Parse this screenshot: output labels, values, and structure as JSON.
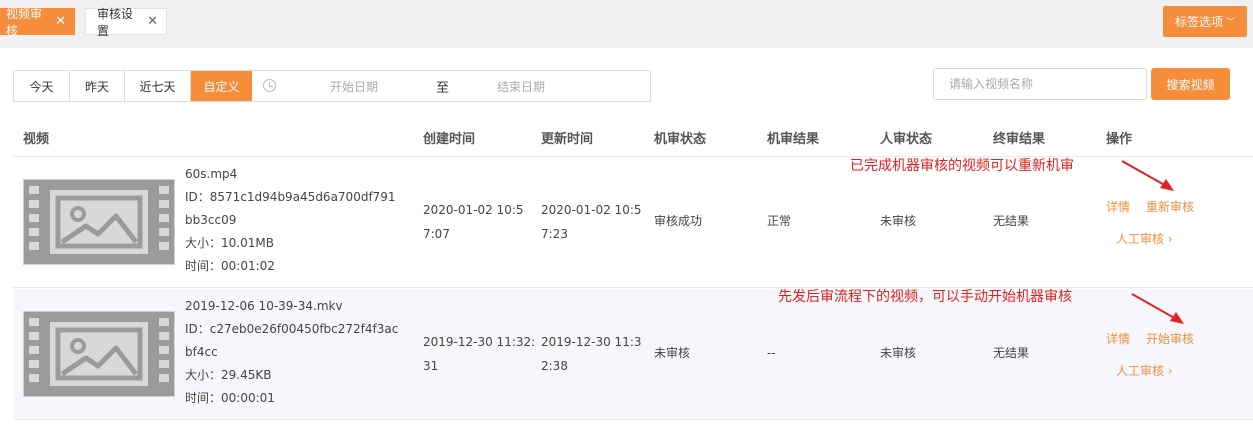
{
  "tabs": [
    {
      "label": "视频审核",
      "active": true
    },
    {
      "label": "审核设置",
      "active": false
    }
  ],
  "tag_options_label": "标签选项",
  "filters": {
    "buttons": [
      "今天",
      "昨天",
      "近七天",
      "自定义"
    ],
    "start_placeholder": "开始日期",
    "separator": "至",
    "end_placeholder": "结束日期"
  },
  "search": {
    "placeholder": "请输入视频名称",
    "button": "搜索视频"
  },
  "columns": [
    "视频",
    "创建时间",
    "更新时间",
    "机审状态",
    "机审结果",
    "人审状态",
    "终审结果",
    "操作"
  ],
  "rows": [
    {
      "filename": "60s.mp4",
      "id_line1": "ID：8571c1d94b9a45d6a700df791",
      "id_line2": "bb3cc09",
      "size": "大小：10.01MB",
      "duration": "时间：00:01:02",
      "created_l1": "2020-01-02 10:5",
      "created_l2": "7:07",
      "updated_l1": "2020-01-02 10:5",
      "updated_l2": "7:23",
      "machine_status": "审核成功",
      "machine_result": "正常",
      "manual_status": "未审核",
      "final_result": "无结果",
      "action_detail": "详情",
      "action_primary": "重新审核",
      "action_manual": "人工审核 ›"
    },
    {
      "filename": "2019-12-06 10-39-34.mkv",
      "id_line1": "ID：c27eb0e26f00450fbc272f4f3ac",
      "id_line2": "bf4cc",
      "size": "大小：29.45KB",
      "duration": "时间：00:00:01",
      "created_l1": "2019-12-30 11:32:",
      "created_l2": "31",
      "updated_l1": "2019-12-30 11:3",
      "updated_l2": "2:38",
      "machine_status": "未审核",
      "machine_result": "--",
      "manual_status": "未审核",
      "final_result": "无结果",
      "action_detail": "详情",
      "action_primary": "开始审核",
      "action_manual": "人工审核 ›"
    }
  ],
  "annotations": [
    "已完成机器审核的视频可以重新机审",
    "先发后审流程下的视频，可以手动开始机器审核"
  ],
  "colors": {
    "accent": "#f58d3b",
    "annotation": "#e62020"
  }
}
